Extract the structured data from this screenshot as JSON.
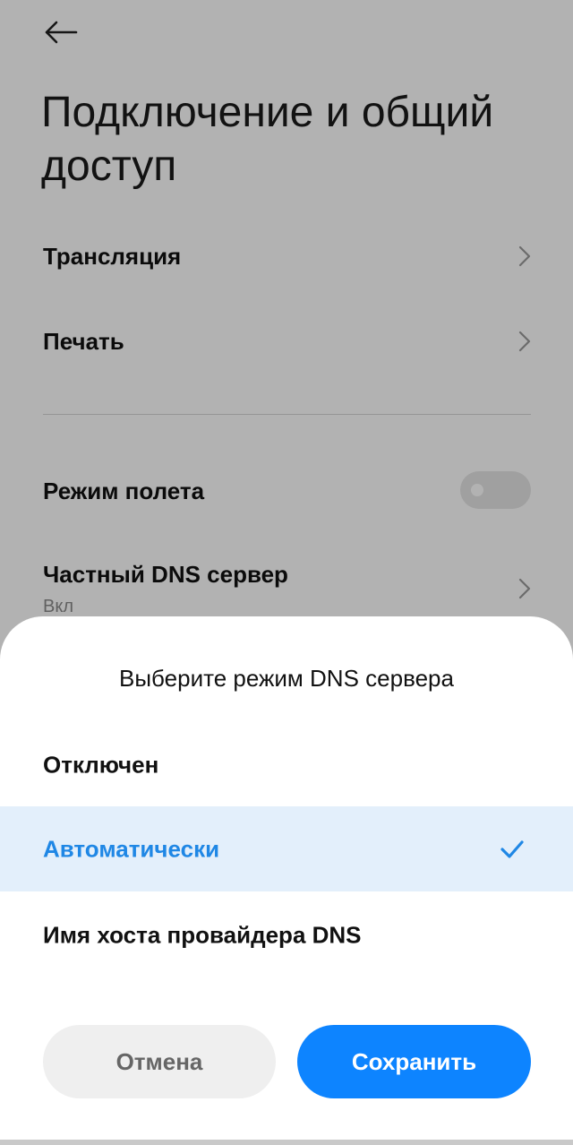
{
  "header": {
    "title": "Подключение и общий доступ",
    "back_icon": "arrow-left-icon"
  },
  "settings": {
    "items": [
      {
        "label": "Трансляция",
        "icon": "chevron-right-icon"
      },
      {
        "label": "Печать",
        "icon": "chevron-right-icon"
      }
    ],
    "airplane_mode": {
      "label": "Режим полета",
      "enabled": false
    },
    "private_dns": {
      "label": "Частный DNS сервер",
      "value": "Вкл",
      "icon": "chevron-right-icon"
    }
  },
  "dialog": {
    "title": "Выберите режим DNS сервера",
    "options": [
      {
        "label": "Отключен",
        "selected": false
      },
      {
        "label": "Автоматически",
        "selected": true
      },
      {
        "label": "Имя хоста провайдера DNS",
        "selected": false
      }
    ],
    "cancel_label": "Отмена",
    "save_label": "Сохранить"
  },
  "colors": {
    "accent": "#0d84ff",
    "selected_text": "#1f87e5",
    "selected_bg": "#e3effb"
  }
}
